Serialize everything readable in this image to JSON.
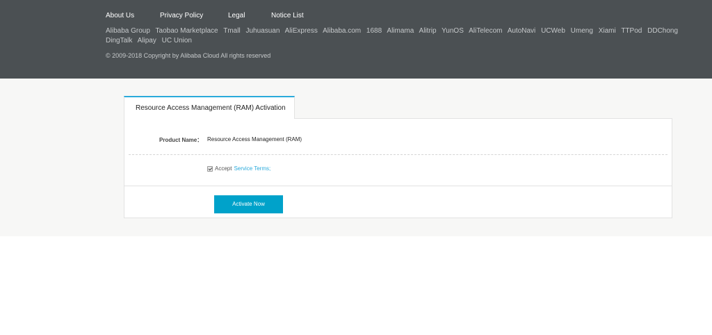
{
  "footer": {
    "main_links": [
      "About Us",
      "Privacy Policy",
      "Legal",
      "Notice List"
    ],
    "group_links": [
      "Alibaba Group",
      "Taobao Marketplace",
      "Tmall",
      "Juhuasuan",
      "AliExpress",
      "Alibaba.com",
      "1688",
      "Alimama",
      "Alitrip",
      "YunOS",
      "AliTelecom",
      "AutoNavi",
      "UCWeb",
      "Umeng",
      "Xiami",
      "TTPod",
      "DDChong",
      "DingTalk",
      "Alipay",
      "UC Union"
    ],
    "copyright": "© 2009-2018 Copyright by Alibaba Cloud All rights reserved"
  },
  "tab": {
    "label": "Resource Access Management (RAM) Activation"
  },
  "form": {
    "product_label": "Product Name：",
    "product_value": "Resource Access Management (RAM)",
    "accept_text": "Accept",
    "terms_link": "Service Terms;",
    "terms_checked": true,
    "activate_label": "Activate Now"
  },
  "colors": {
    "footer_bg": "#4b5053",
    "accent": "#00a2ca",
    "link": "#2aaadb"
  }
}
